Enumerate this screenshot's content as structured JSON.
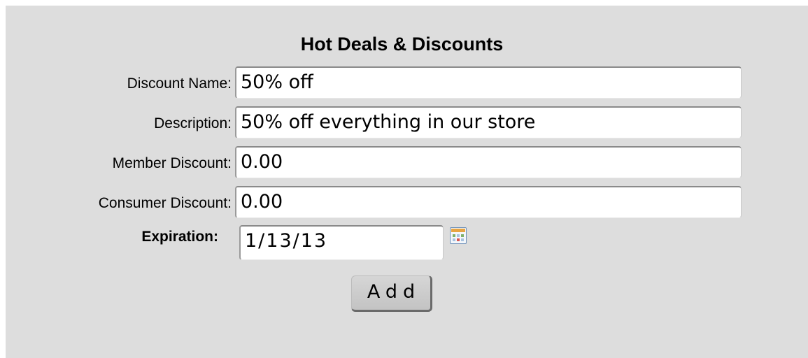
{
  "form": {
    "title": "Hot Deals & Discounts",
    "discount_name_label": "Discount Name:",
    "discount_name_value": "50% off",
    "description_label": "Description:",
    "description_value": "50% off everything in our store",
    "member_discount_label": "Member Discount:",
    "member_discount_value": "0.00",
    "consumer_discount_label": "Consumer Discount:",
    "consumer_discount_value": "0.00",
    "expiration_label": "Expiration:",
    "expiration_value": "1/13/13",
    "calendar_icon": "calendar-icon",
    "add_button_label": "Add"
  }
}
